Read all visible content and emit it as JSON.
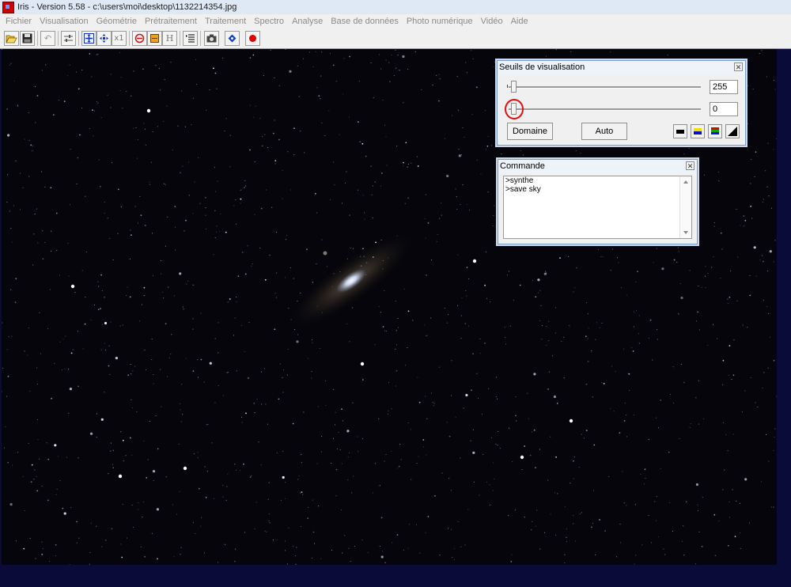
{
  "window": {
    "title": "Iris - Version 5.58 - c:\\users\\moi\\desktop\\1132214354.jpg"
  },
  "menu": [
    "Fichier",
    "Visualisation",
    "Géométrie",
    "Prétraitement",
    "Traitement",
    "Spectro",
    "Analyse",
    "Base de données",
    "Photo numérique",
    "Vidéo",
    "Aide"
  ],
  "toolbar": {
    "zoom_label": "x1",
    "histogram_label": "H"
  },
  "thresholds_panel": {
    "title": "Seuils de visualisation",
    "high_value": "255",
    "low_value": "0",
    "domain_button": "Domaine",
    "auto_button": "Auto"
  },
  "command_panel": {
    "title": "Commande",
    "lines": [
      ">synthe",
      ">save sky"
    ]
  },
  "colors": {
    "background": "#0b0b3a",
    "image_background": "#05050b",
    "menu_disabled_text": "#8a8a8a",
    "highlight_circle": "#e01010"
  }
}
